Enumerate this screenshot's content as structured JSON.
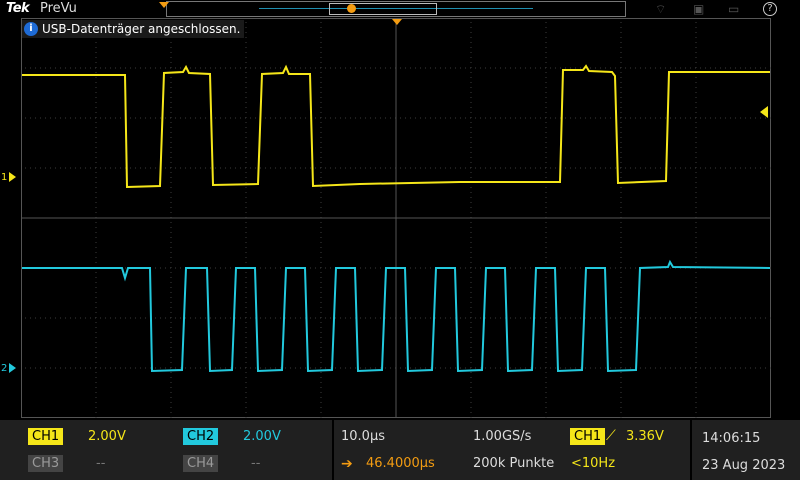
{
  "topbar": {
    "brand": "Tek",
    "mode": "PreVu"
  },
  "notification": {
    "text": "USB-Datenträger angeschlossen."
  },
  "channels": [
    {
      "label": "CH1",
      "scale": "2.00V",
      "color": "#f5e619"
    },
    {
      "label": "CH2",
      "scale": "2.00V",
      "color": "#22c9dd"
    },
    {
      "label": "CH3",
      "scale": "--",
      "color": "#9a9a9a"
    },
    {
      "label": "CH4",
      "scale": "--",
      "color": "#9a9a9a"
    }
  ],
  "ground_markers": {
    "ch1": "1",
    "ch2": "2"
  },
  "horizontal": {
    "time_per_div": "10.0µs",
    "position": "46.4000µs",
    "sample_rate": "1.00GS/s",
    "record_length": "200k Punkte"
  },
  "trigger": {
    "source": "CH1",
    "level": "3.36V",
    "frequency": "<10Hz"
  },
  "clock": {
    "time": "14:06:15",
    "date": "23 Aug 2023"
  },
  "colors": {
    "ch1": "#f5e619",
    "ch2": "#22c9dd",
    "trigger": "#f39c12",
    "grid": "#444444"
  }
}
